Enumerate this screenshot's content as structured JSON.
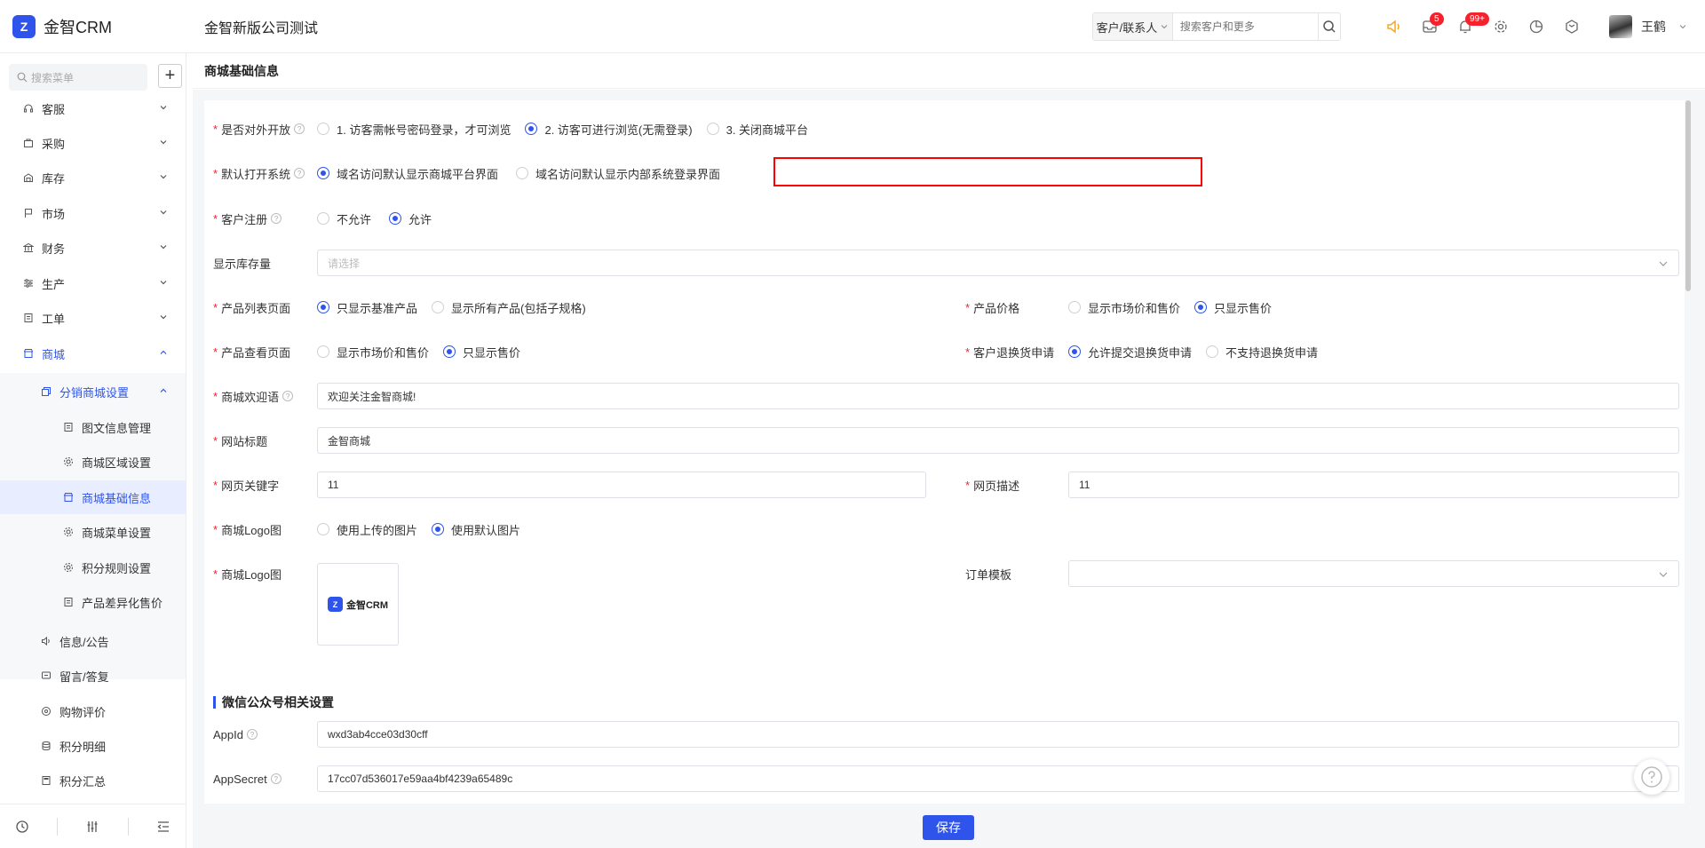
{
  "header": {
    "logo_text": "金智CRM",
    "company": "金智新版公司测试",
    "search_type": "客户/联系人",
    "search_placeholder": "搜索客户和更多",
    "badge_messages": "5",
    "badge_notifications": "99+",
    "username": "王鹤"
  },
  "sidebar": {
    "search_placeholder": "搜索菜单",
    "items": [
      {
        "label": "客服",
        "icon": "headset-icon"
      },
      {
        "label": "采购",
        "icon": "bag-icon"
      },
      {
        "label": "库存",
        "icon": "warehouse-icon"
      },
      {
        "label": "市场",
        "icon": "flag-icon"
      },
      {
        "label": "财务",
        "icon": "bank-icon"
      },
      {
        "label": "生产",
        "icon": "sliders-icon"
      },
      {
        "label": "工单",
        "icon": "ticket-icon"
      },
      {
        "label": "商城",
        "icon": "shop-icon"
      }
    ],
    "sub_group": "分销商城设置",
    "sub_items": [
      "图文信息管理",
      "商城区域设置",
      "商城基础信息",
      "商城菜单设置",
      "积分规则设置",
      "产品差异化售价"
    ],
    "more_items": [
      "信息/公告",
      "留言/答复",
      "购物评价",
      "积分明细",
      "积分汇总"
    ]
  },
  "page": {
    "title": "商城基础信息",
    "save_label": "保存"
  },
  "form": {
    "open_label": "是否对外开放",
    "open_options": [
      "1. 访客需帐号密码登录，才可浏览",
      "2. 访客可进行浏览(无需登录)",
      "3. 关闭商城平台"
    ],
    "open_selected": 1,
    "default_sys_label": "默认打开系统",
    "default_sys_options": [
      "域名访问默认显示商城平台界面",
      "域名访问默认显示内部系统登录界面"
    ],
    "default_sys_selected": 0,
    "register_label": "客户注册",
    "register_options": [
      "不允许",
      "允许"
    ],
    "register_selected": 1,
    "stock_label": "显示库存量",
    "stock_placeholder": "请选择",
    "product_list_label": "产品列表页面",
    "product_list_options": [
      "只显示基准产品",
      "显示所有产品(包括子规格)"
    ],
    "product_list_selected": 0,
    "price_label": "产品价格",
    "price_options": [
      "显示市场价和售价",
      "只显示售价"
    ],
    "price_selected": 1,
    "product_view_label": "产品查看页面",
    "product_view_options": [
      "显示市场价和售价",
      "只显示售价"
    ],
    "product_view_selected": 1,
    "return_label": "客户退换货申请",
    "return_options": [
      "允许提交退换货申请",
      "不支持退换货申请"
    ],
    "return_selected": 0,
    "welcome_label": "商城欢迎语",
    "welcome_value": "欢迎关注金智商城!",
    "site_title_label": "网站标题",
    "site_title_value": "金智商城",
    "keywords_label": "网页关键字",
    "keywords_value": "11",
    "desc_label": "网页描述",
    "desc_value": "11",
    "logo_mode_label": "商城Logo图",
    "logo_mode_options": [
      "使用上传的图片",
      "使用默认图片"
    ],
    "logo_mode_selected": 1,
    "logo_label": "商城Logo图",
    "logo_preview_text": "金智CRM",
    "order_template_label": "订单模板",
    "wechat_section": "微信公众号相关设置",
    "appid_label": "AppId",
    "appid_value": "wxd3ab4cce03d30cff",
    "appsecret_label": "AppSecret",
    "appsecret_value": "17cc07d536017e59aa4bf4239a65489c"
  },
  "colors": {
    "accent": "#2f54eb",
    "required": "#f5222d",
    "highlight_box": "#ff0000"
  }
}
